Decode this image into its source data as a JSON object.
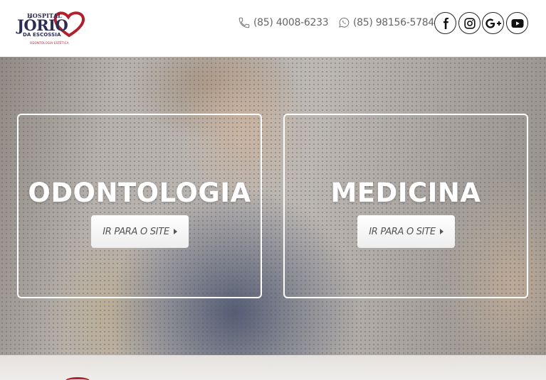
{
  "brand": {
    "line1": "HOSPITAL",
    "line2": "JÓRIO",
    "line3": "DA ESCOSSIA",
    "line4": "ODONTOLOGIA ESTÉTICA",
    "accent_color": "#b21f2d",
    "text_color": "#2c2c54"
  },
  "contacts": {
    "phone": "(85) 4008-6233",
    "phone_icon": "phone-icon",
    "whatsapp": "(85) 98156-5784",
    "whatsapp_icon": "whatsapp-icon"
  },
  "social": [
    "facebook-icon",
    "instagram-icon",
    "google-plus-icon",
    "youtube-icon"
  ],
  "cards": [
    {
      "title": "ODONTOLOGIA",
      "button_label": "IR PARA O SITE",
      "button_icon": "caret-right-icon"
    },
    {
      "title": "MEDICINA",
      "button_label": "IR PARA O SITE",
      "button_icon": "caret-right-icon"
    }
  ]
}
